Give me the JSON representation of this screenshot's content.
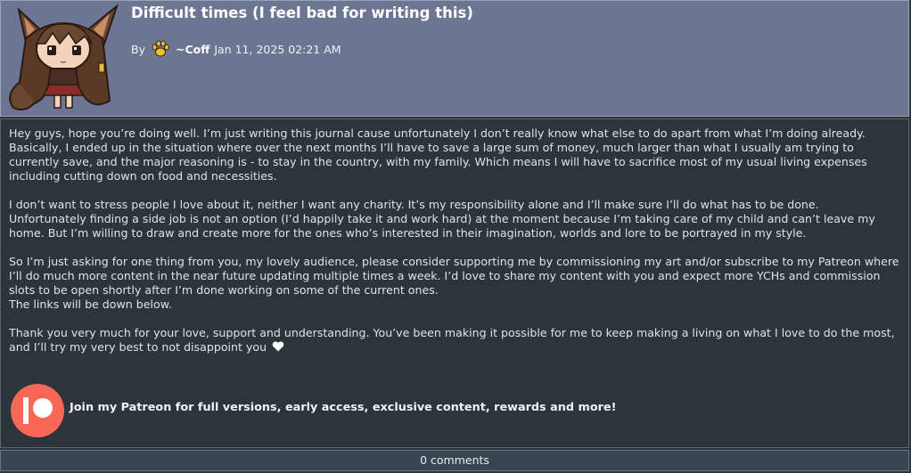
{
  "journal": {
    "title": "Difficult times (I feel bad for writing this)",
    "by_label": "By",
    "author": "~Coff",
    "date": "Jan 11, 2025 02:21 AM",
    "author_icon": "paw-icon"
  },
  "content": {
    "p1": [
      "Hey guys, hope you’re doing well. I’m just writing this journal cause unfortunately I don’t really know what else to do apart from what I’m doing already.",
      "Basically, I ended up in the situation where over the next months I’ll have to save a large sum of money, much larger than what I usually am trying to currently save, and the major reasoning is - to stay in the country, with my family. Which means I will have to sacrifice most of my usual living expenses including cutting down on food and necessities."
    ],
    "p2": [
      "I don’t want to stress people I love about it, neither I want any charity. It’s my responsibility alone and I’ll make sure I’ll do what has to be done.",
      "Unfortunately finding a side job is not an option (I’d happily take it and work hard) at the moment because I’m taking care of my child and can’t leave my home. But I’m willing to draw and create more for the ones who’s interested in their imagination, worlds and lore to be portrayed in my style."
    ],
    "p3": [
      "So I’m just asking for one thing from you, my lovely audience, please consider supporting me by commissioning my art and/or subscribe to my Patreon where I’ll do much more content in the near future updating multiple times a week. I’d love to share my content with you and expect more YCHs and commission slots to be open shortly after I’m done working on some of the current ones.",
      "The links will be down below."
    ],
    "p4": "Thank you very much for your love, support and understanding. You’ve been making it possible for me to keep making a living on what I love to do the most, and I’ll try my very best to not disappoint you"
  },
  "patreon": {
    "cta": "Join my Patreon for full versions, early access, exclusive content, rewards and more!",
    "icon": "patreon-icon",
    "color": "#f96854"
  },
  "footer": {
    "comments": "0 comments"
  },
  "colors": {
    "header_bg": "#6c7592",
    "body_bg": "#2b353a",
    "footer_bg": "#3a4553"
  }
}
